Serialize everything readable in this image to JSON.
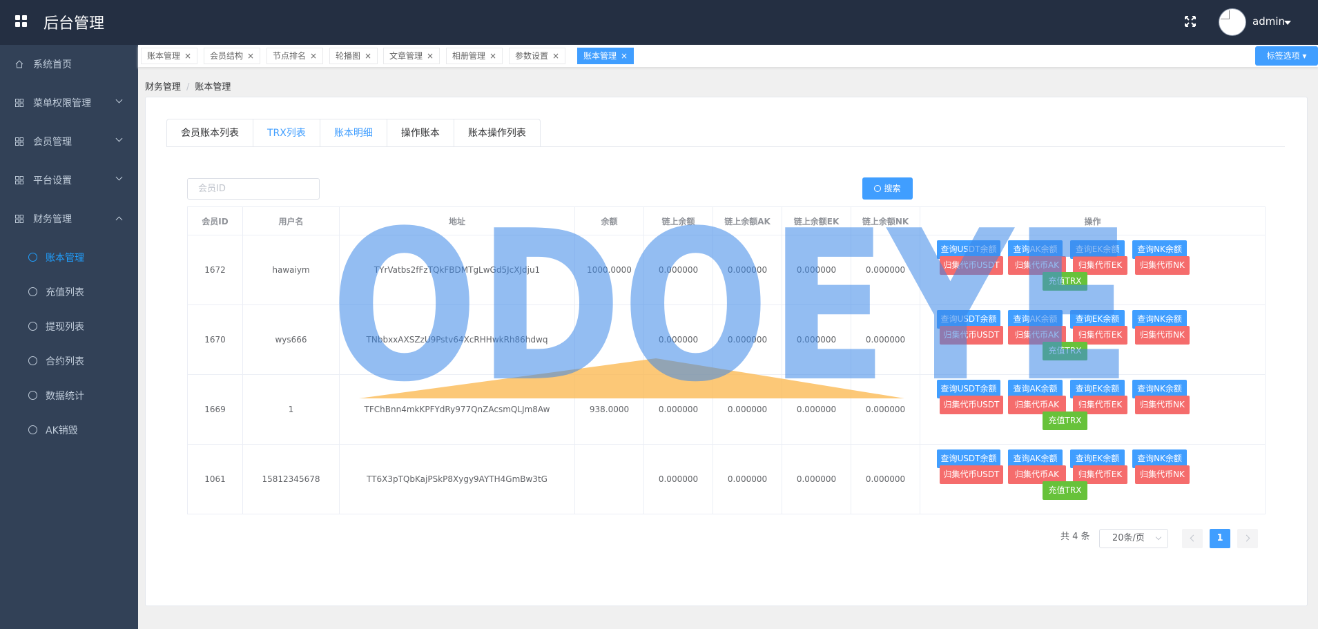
{
  "header": {
    "title": "后台管理",
    "user": "admin"
  },
  "sidebar": {
    "items": [
      {
        "label": "系统首页"
      },
      {
        "label": "菜单权限管理"
      },
      {
        "label": "会员管理"
      },
      {
        "label": "平台设置"
      },
      {
        "label": "财务管理"
      }
    ],
    "sub_items": [
      {
        "label": "账本管理"
      },
      {
        "label": "充值列表"
      },
      {
        "label": "提现列表"
      },
      {
        "label": "合约列表"
      },
      {
        "label": "数据统计"
      },
      {
        "label": "AK销毁"
      }
    ]
  },
  "tags": {
    "items": [
      {
        "label": "账本管理"
      },
      {
        "label": "会员结构"
      },
      {
        "label": "节点排名"
      },
      {
        "label": "轮播图"
      },
      {
        "label": "文章管理"
      },
      {
        "label": "相册管理"
      },
      {
        "label": "参数设置"
      },
      {
        "label": "账本管理"
      }
    ],
    "close": "×",
    "options_label": "标签选项"
  },
  "breadcrumb": {
    "parent": "财务管理",
    "sep": "/",
    "current": "账本管理"
  },
  "tabs": [
    {
      "label": "会员账本列表"
    },
    {
      "label": "TRX列表"
    },
    {
      "label": "账本明细"
    },
    {
      "label": "操作账本"
    },
    {
      "label": "账本操作列表"
    }
  ],
  "search": {
    "placeholder": "会员ID",
    "button_label": "搜索"
  },
  "table": {
    "columns": [
      "会员ID",
      "用户名",
      "地址",
      "余额",
      "链上余额",
      "链上余额AK",
      "链上余额EK",
      "链上余额NK",
      "操作"
    ],
    "rows": [
      {
        "id": "1672",
        "username": "hawaiym",
        "address": "TYrVatbs2fFzTQkFBDMTgLwGd5JcXJdju1",
        "balance": "1000.0000",
        "chain": "0.000000",
        "ak": "0.000000",
        "ek": "0.000000",
        "nk": "0.000000"
      },
      {
        "id": "1670",
        "username": "wys666",
        "address": "TNbbxxAXSZzU9Pstv64XcRHHwkRh86hdwq",
        "balance": "",
        "chain": "0.000000",
        "ak": "0.000000",
        "ek": "0.000000",
        "nk": "0.000000"
      },
      {
        "id": "1669",
        "username": "1",
        "address": "TFChBnn4mkKPFYdRy977QnZAcsmQLJm8Aw",
        "balance": "938.0000",
        "chain": "0.000000",
        "ak": "0.000000",
        "ek": "0.000000",
        "nk": "0.000000"
      },
      {
        "id": "1061",
        "username": "15812345678",
        "address": "TT6X3pTQbKajPSkP8Xygy9AYTH4GmBw3tG",
        "balance": "",
        "chain": "0.000000",
        "ak": "0.000000",
        "ek": "0.000000",
        "nk": "0.000000"
      }
    ],
    "actions": {
      "query_usdt": "查询USDT余额",
      "query_ak": "查询AK余额",
      "query_ek": "查询EK余额",
      "query_nk": "查询NK余额",
      "collect_usdt": "归集代币USDT",
      "collect_ak": "归集代币AK",
      "collect_ek": "归集代币EK",
      "collect_nk": "归集代币NK",
      "recharge_trx": "充值TRX"
    }
  },
  "pagination": {
    "total": "共 4 条",
    "page_size": "20条/页",
    "current_page": "1"
  },
  "watermark": {
    "text": "ODOEYE"
  },
  "colors": {
    "primary": "#409eff",
    "danger": "#f56c6c",
    "success": "#67c23a",
    "sidebar": "#324157",
    "header": "#242f42"
  }
}
